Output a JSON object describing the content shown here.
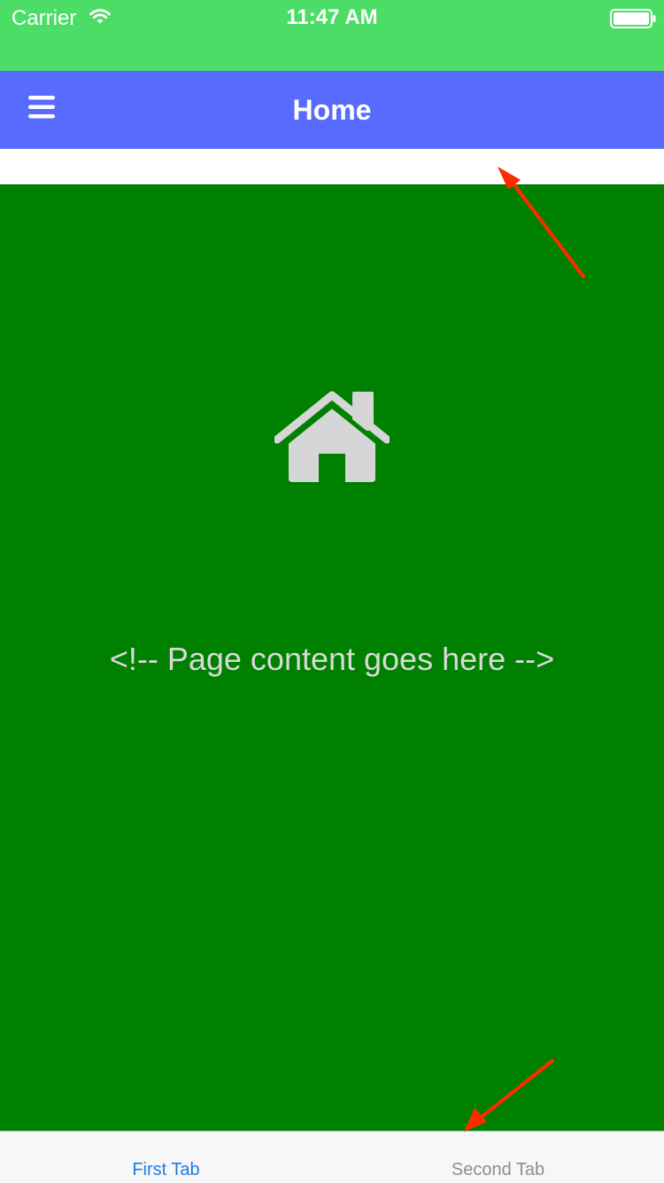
{
  "status_bar": {
    "carrier": "Carrier",
    "time": "11:47 AM",
    "wifi_icon": "wifi-icon",
    "battery_icon": "battery-icon"
  },
  "nav_bar": {
    "title": "Home",
    "menu_icon": "hamburger-menu-icon"
  },
  "content": {
    "icon": "home-icon",
    "text": "<!-- Page content goes here -->"
  },
  "tabs": [
    {
      "label": "First Tab",
      "selected": true
    },
    {
      "label": "Second Tab",
      "selected": false
    }
  ],
  "colors": {
    "status_bar_bg": "#4cdd67",
    "nav_bar_bg": "#586bff",
    "content_bg": "#008000",
    "content_text": "#d9d9d9",
    "tab_active": "#1a7ee6",
    "tab_inactive": "#8e8e93",
    "annotation_arrow": "#ff2a00"
  }
}
